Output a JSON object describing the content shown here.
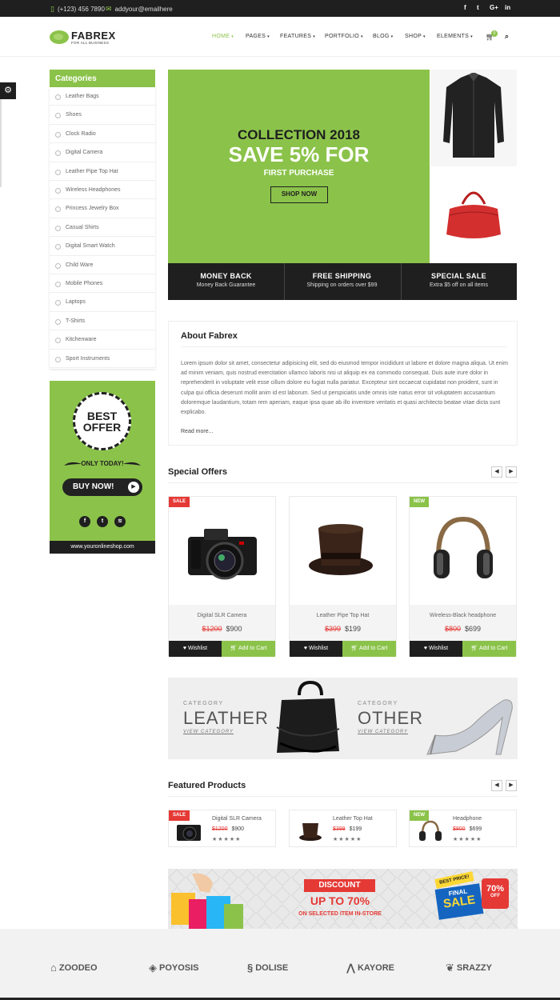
{
  "topbar": {
    "phone": "(+123) 456 7890",
    "email": "addyour@emailhere",
    "social": [
      "f",
      "t",
      "G+",
      "in"
    ]
  },
  "brand": {
    "name": "FABREX",
    "tagline": "FOR ALL BUSINESS"
  },
  "nav": {
    "items": [
      "HOME",
      "PAGES",
      "FEATURES",
      "PORTFOLIO",
      "BLOG",
      "SHOP",
      "ELEMENTS"
    ],
    "active": "HOME",
    "cart_count": "0"
  },
  "categories": {
    "title": "Categories",
    "items": [
      "Leather Bags",
      "Shoes",
      "Clock Radio",
      "Digital Camera",
      "Leather Pipe Top Hat",
      "Wireless Headphones",
      "Princess Jewelry Box",
      "Casual Shirts",
      "Digital Smart Watch",
      "Child Ware",
      "Mobile Phones",
      "Laptops",
      "T-Shirts",
      "Kitchenware",
      "Sport Instruments"
    ]
  },
  "offer": {
    "badge_line1": "BEST",
    "badge_line2": "OFFER",
    "only_today": "ONLY TODAY!",
    "button": "BUY NOW!",
    "url": "www.youronlineshop.com"
  },
  "hero": {
    "line1": "COLLECTION 2018",
    "line2": "SAVE 5% FOR",
    "line3": "FIRST PURCHASE",
    "button": "SHOP NOW"
  },
  "features": [
    {
      "title": "MONEY BACK",
      "sub": "Money Back Guarantee"
    },
    {
      "title": "FREE SHIPPING",
      "sub": "Shipping on orders over $99"
    },
    {
      "title": "SPECIAL SALE",
      "sub": "Extra $5 off on all items"
    }
  ],
  "about": {
    "title": "About Fabrex",
    "text": "Lorem ipsum dolor sit amet, consectetur adipisicing elit, sed do eiusmod tempor incididunt ut labore et dolore magna aliqua. Ut enim ad minim veniam, quis nostrud exercitation ullamco laboris nisi ut aliquip ex ea commodo consequat. Duis aute irure dolor in reprehenderit in voluptate velit esse cillum dolore eu fugiat nulla pariatur. Excepteur sint occaecat cupidatat non proident, sunt in culpa qui officia deserunt mollit anim id est laborum. Sed ut perspiciatis unde omnis iste natus error sit voluptatem accusantium doloremque laudantium, totam rem aperiam, eaque ipsa quae ab illo inventore veritatis et quasi architecto beatae vitae dicta sunt explicabo.",
    "more": "Read more..."
  },
  "special_offers": {
    "title": "Special Offers",
    "wishlist": "Wishlist",
    "add_to_cart": "Add to Cart",
    "products": [
      {
        "name": "Digital SLR Camera",
        "old": "$1200",
        "price": "$900",
        "tag": "SALE"
      },
      {
        "name": "Leather Pipe Top Hat",
        "old": "$399",
        "price": "$199",
        "tag": ""
      },
      {
        "name": "Wireless-Black headphone",
        "old": "$800",
        "price": "$699",
        "tag": "NEW"
      }
    ]
  },
  "category_banner": {
    "left_small": "CATEGORY",
    "left_big": "LEATHER",
    "left_link": "VIEW CATEGORY",
    "right_small": "CATEGORY",
    "right_big": "OTHER",
    "right_link": "VIEW CATEGORY"
  },
  "featured": {
    "title": "Featured Products",
    "stars": "★★★★★",
    "products": [
      {
        "name": "Digital SLR Camera",
        "old": "$1200",
        "price": "$900",
        "tag": "SALE"
      },
      {
        "name": "Leather Top Hat",
        "old": "$399",
        "price": "$199",
        "tag": ""
      },
      {
        "name": "Headphone",
        "old": "$800",
        "price": "$699",
        "tag": "NEW"
      }
    ]
  },
  "discount": {
    "label": "DISCOUNT",
    "big": "UP TO 70%",
    "sub": "ON SELECTED ITEM IN-STORE",
    "best": "BEST PRICE!",
    "final": "FINAL",
    "sale": "SALE",
    "pct": "70%",
    "off": "OFF"
  },
  "brands": [
    "ZOODEO",
    "POYOSIS",
    "DOLISE",
    "KAYORE",
    "SRAZZY"
  ],
  "colors": {
    "accent": "#8bc34a",
    "dark": "#1f1f1f",
    "sale": "#e53935"
  }
}
